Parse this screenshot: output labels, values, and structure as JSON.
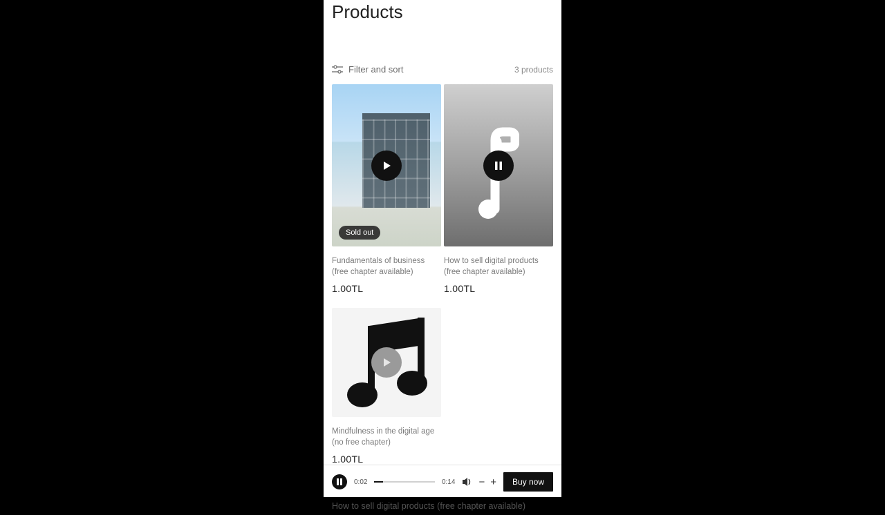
{
  "page": {
    "title": "Products",
    "filter_label": "Filter and sort",
    "count_label": "3 products"
  },
  "products": [
    {
      "title": "Fundamentals of business (free chapter available)",
      "price": "1.00TL",
      "badge": "Sold out",
      "state": "play"
    },
    {
      "title": "How to sell digital products (free chapter available)",
      "price": "1.00TL",
      "state": "pause"
    },
    {
      "title": "Mindfulness in the digital age (no free chapter)",
      "price": "1.00TL",
      "state": "play"
    }
  ],
  "player": {
    "current_time": "0:02",
    "duration": "0:14",
    "buy_label": "Buy now",
    "now_playing": "How to sell digital products (free chapter available)"
  }
}
